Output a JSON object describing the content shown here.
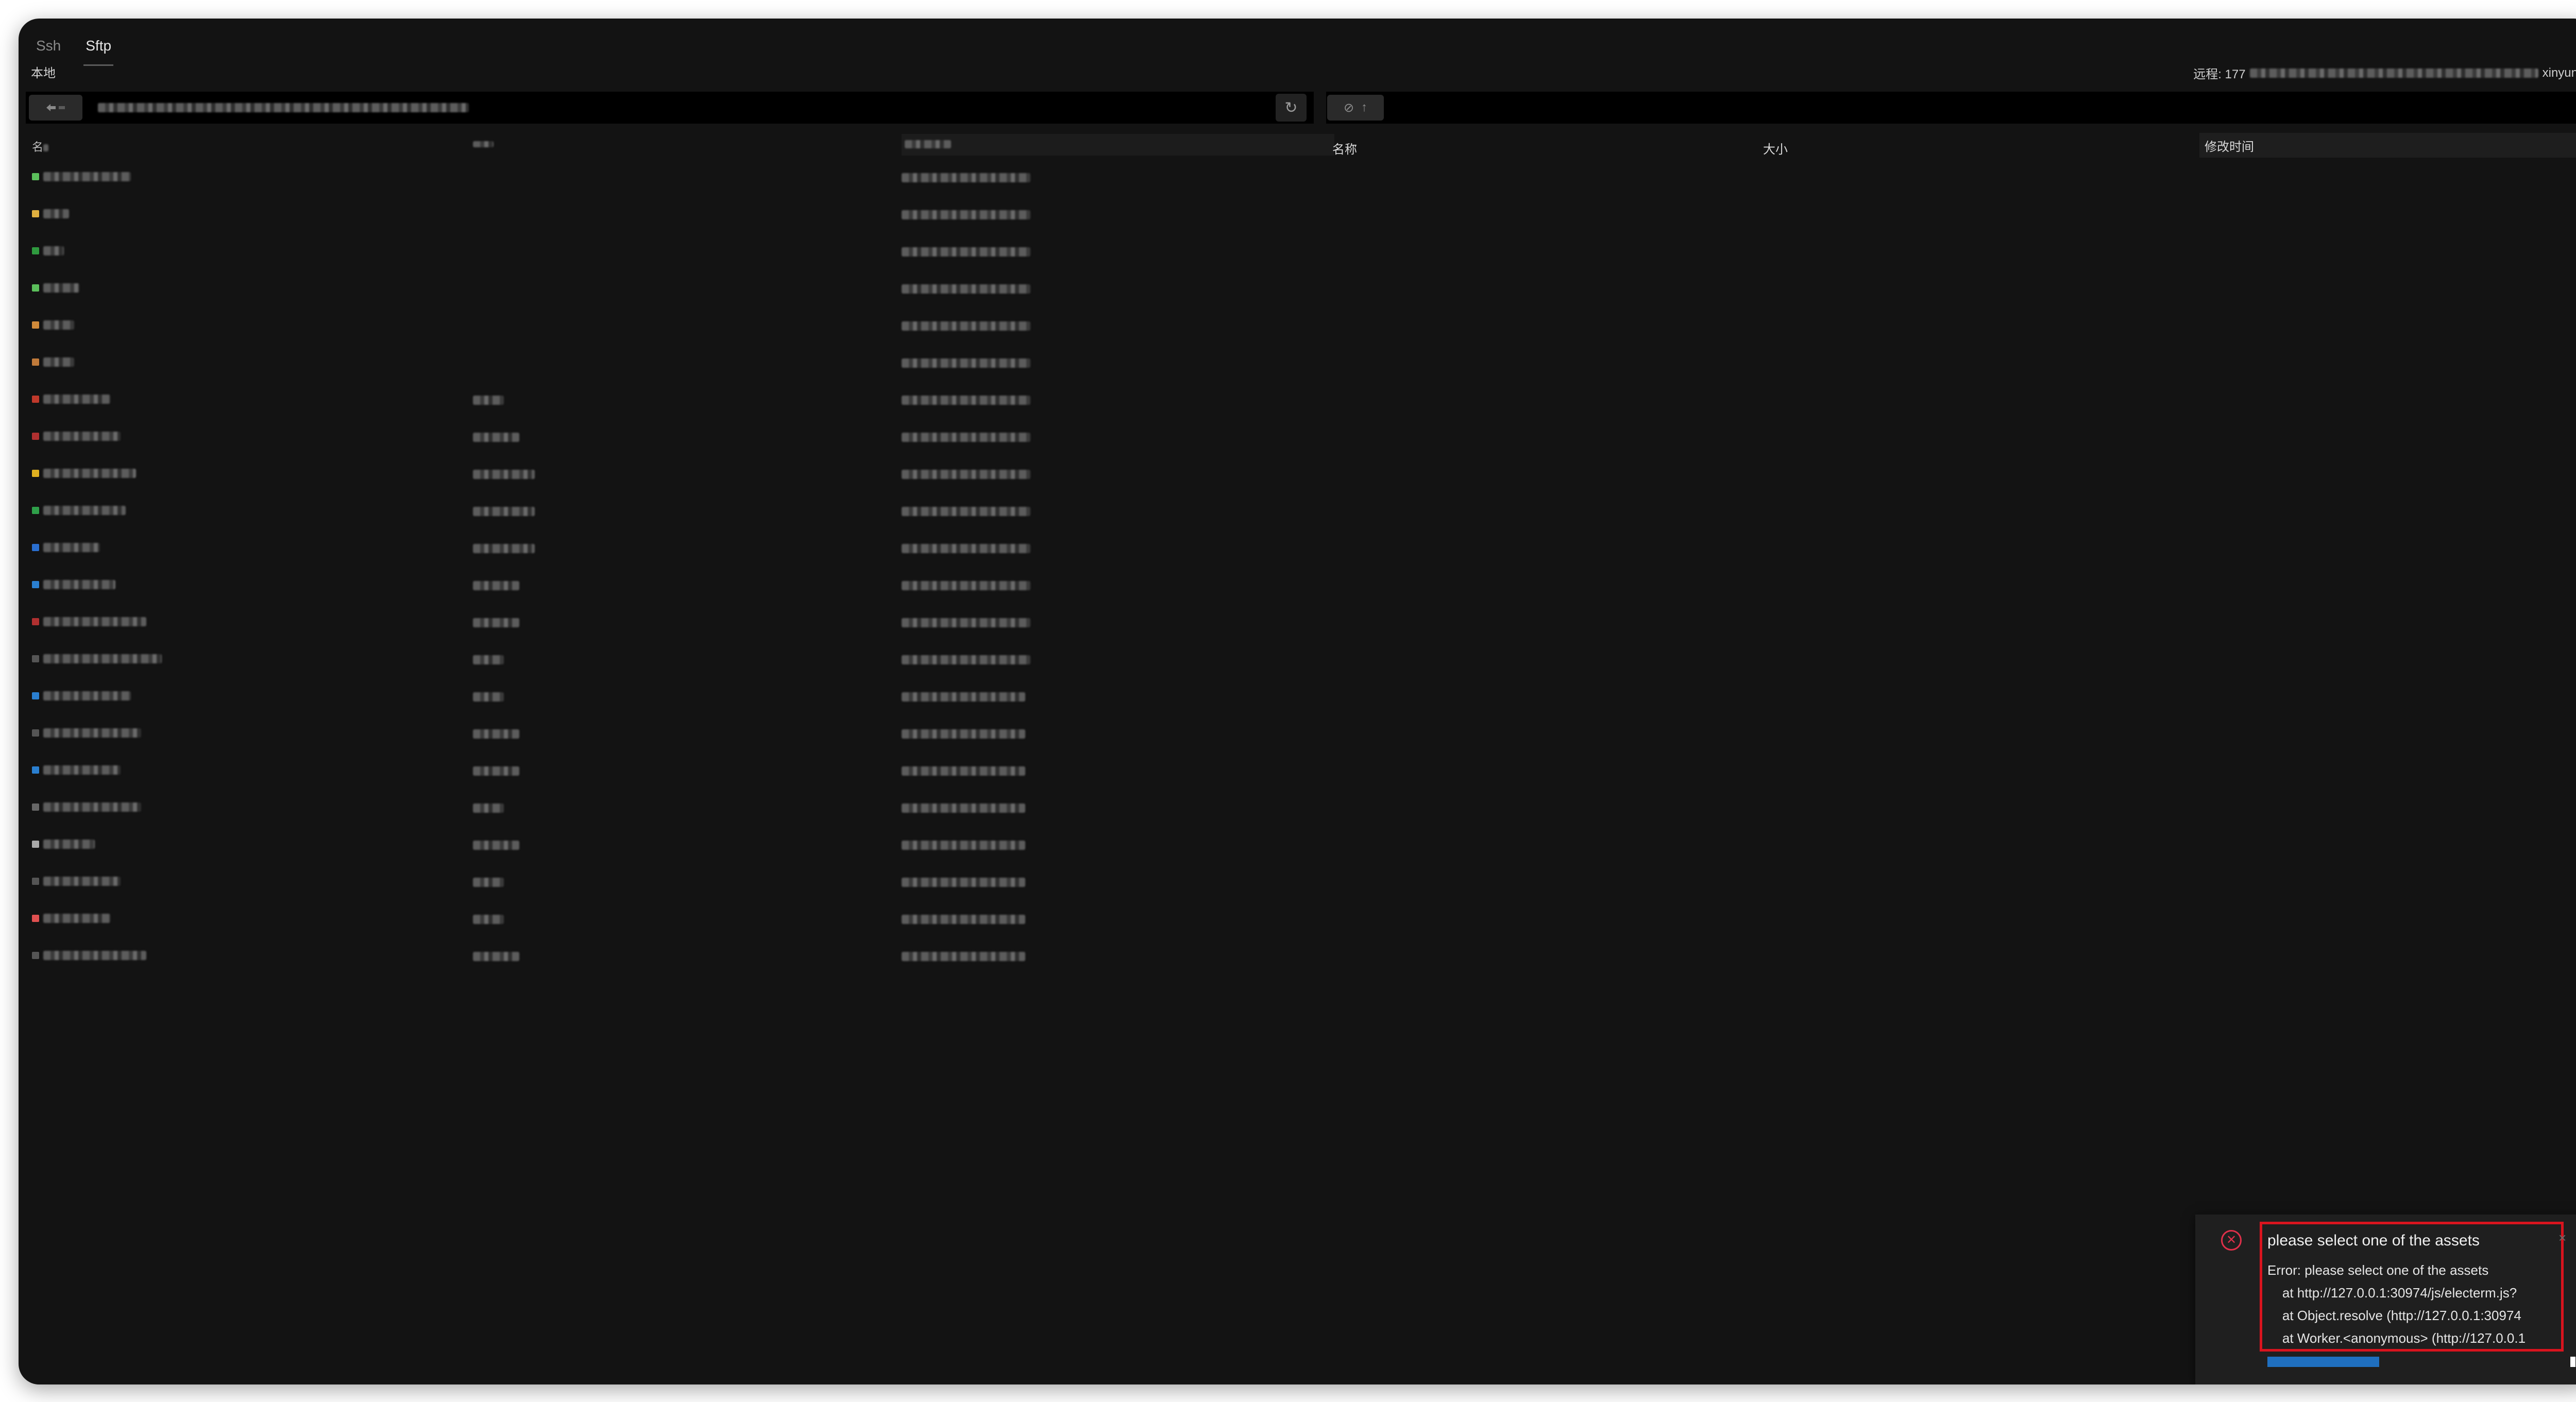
{
  "tabs": [
    {
      "label": "Ssh",
      "active": false
    },
    {
      "label": "Sftp",
      "active": true
    }
  ],
  "local": {
    "label": "本地",
    "column_name_glyph": "名",
    "refresh_icon": "refresh-icon",
    "rows": [
      {
        "icon": "folder-icon",
        "color": "#5bbf5b",
        "name_w": 170,
        "size_w": 0,
        "date_w": 250
      },
      {
        "icon": "folder-icon",
        "color": "#e0b040",
        "name_w": 50,
        "size_w": 0,
        "date_w": 250
      },
      {
        "icon": "folder-icon",
        "color": "#2f9a3f",
        "name_w": 40,
        "size_w": 0,
        "date_w": 250
      },
      {
        "icon": "folder-icon",
        "color": "#5bbf5b",
        "name_w": 70,
        "size_w": 0,
        "date_w": 250
      },
      {
        "icon": "folder-icon",
        "color": "#d08a3a",
        "name_w": 60,
        "size_w": 0,
        "date_w": 250
      },
      {
        "icon": "folder-icon",
        "color": "#c07a3a",
        "name_w": 60,
        "size_w": 0,
        "date_w": 250
      },
      {
        "icon": "file-icon",
        "color": "#c0392b",
        "name_w": 130,
        "size_w": 60,
        "date_w": 250
      },
      {
        "icon": "file-icon",
        "color": "#b03030",
        "name_w": 150,
        "size_w": 90,
        "date_w": 250
      },
      {
        "icon": "file-icon",
        "color": "#e0b020",
        "name_w": 180,
        "size_w": 120,
        "date_w": 250
      },
      {
        "icon": "file-icon",
        "color": "#2fa04a",
        "name_w": 160,
        "size_w": 120,
        "date_w": 250
      },
      {
        "icon": "file-icon",
        "color": "#2a6fd0",
        "name_w": 110,
        "size_w": 120,
        "date_w": 250
      },
      {
        "icon": "file-icon",
        "color": "#2a7fd0",
        "name_w": 140,
        "size_w": 90,
        "date_w": 250
      },
      {
        "icon": "file-icon",
        "color": "#b03030",
        "name_w": 200,
        "size_w": 90,
        "date_w": 250
      },
      {
        "icon": "file-icon",
        "color": "#555555",
        "name_w": 230,
        "size_w": 60,
        "date_w": 250
      },
      {
        "icon": "file-icon",
        "color": "#2a7fd0",
        "name_w": 170,
        "size_w": 60,
        "date_w": 240
      },
      {
        "icon": "file-icon",
        "color": "#555555",
        "name_w": 190,
        "size_w": 90,
        "date_w": 240
      },
      {
        "icon": "file-icon",
        "color": "#2a7fd0",
        "name_w": 150,
        "size_w": 90,
        "date_w": 240
      },
      {
        "icon": "file-icon",
        "color": "#666666",
        "name_w": 190,
        "size_w": 60,
        "date_w": 240
      },
      {
        "icon": "file-icon",
        "color": "#aaaaaa",
        "name_w": 100,
        "size_w": 90,
        "date_w": 240
      },
      {
        "icon": "file-icon",
        "color": "#555555",
        "name_w": 150,
        "size_w": 60,
        "date_w": 240
      },
      {
        "icon": "file-icon",
        "color": "#e05050",
        "name_w": 130,
        "size_w": 60,
        "date_w": 240
      },
      {
        "icon": "file-icon",
        "color": "#555555",
        "name_w": 200,
        "size_w": 90,
        "date_w": 240
      }
    ]
  },
  "remote": {
    "label_prefix": "远程: 177",
    "label_suffix": "xinyun.co",
    "columns": {
      "name": "名称",
      "size": "大小",
      "mtime": "修改时间"
    },
    "refresh_icon": "refresh-icon"
  },
  "notification": {
    "title": "please select one of the assets",
    "close": "×",
    "body": "Error: please select one of the assets\n    at http://127.0.0.1:30974/js/electerm.js?\n    at Object.resolve (http://127.0.0.1:30974\n    at Worker.<anonymous> (http://127.0.0.1",
    "progress_percent": 38,
    "accent": "#1f6fbf",
    "error_color": "#e0304a"
  }
}
